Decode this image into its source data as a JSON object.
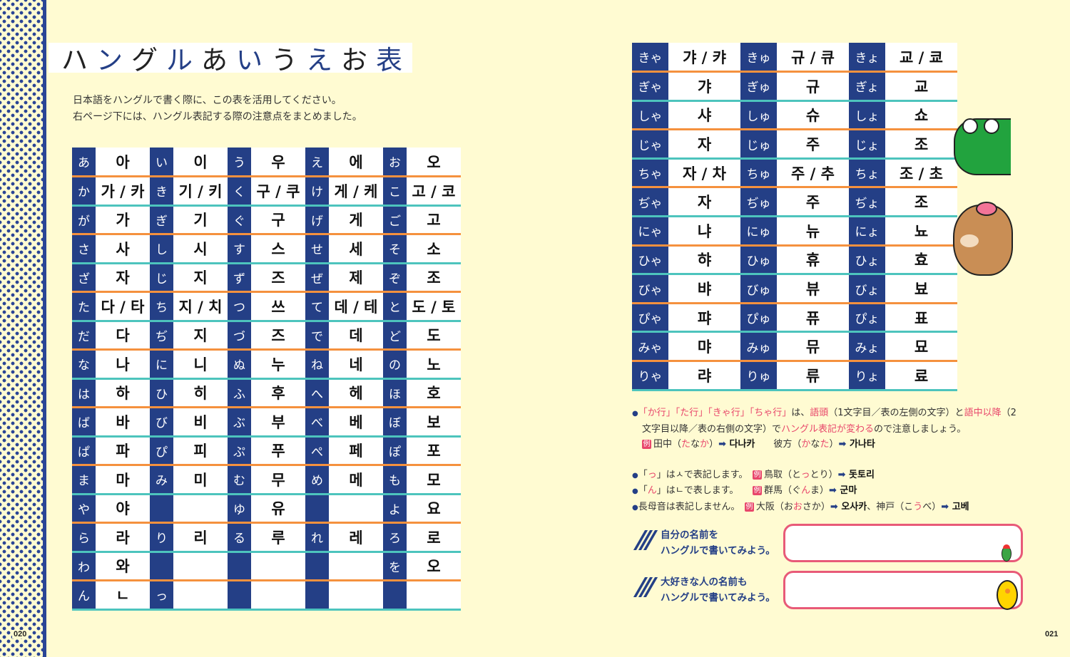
{
  "page_numbers": {
    "left": "020",
    "right": "021"
  },
  "title": {
    "parts": [
      {
        "t": "ハ",
        "c": "k"
      },
      {
        "t": "ン",
        "c": "b"
      },
      {
        "t": "グ",
        "c": "k"
      },
      {
        "t": "ル",
        "c": "b"
      },
      {
        "t": "あ",
        "c": "k"
      },
      {
        "t": "い",
        "c": "b"
      },
      {
        "t": "う",
        "c": "k"
      },
      {
        "t": "え",
        "c": "b"
      },
      {
        "t": "お",
        "c": "k"
      },
      {
        "t": "表",
        "c": "b"
      }
    ]
  },
  "intro": [
    "日本語をハングルで書く際に、この表を活用してください。",
    "右ページ下には、ハングル表記する際の注意点をまとめました。"
  ],
  "left_table": [
    [
      "あ",
      "아",
      "い",
      "이",
      "う",
      "우",
      "え",
      "에",
      "お",
      "오"
    ],
    [
      "か",
      "가 / 카",
      "き",
      "기 / 키",
      "く",
      "구 / 쿠",
      "け",
      "게 / 케",
      "こ",
      "고 / 코"
    ],
    [
      "が",
      "가",
      "ぎ",
      "기",
      "ぐ",
      "구",
      "げ",
      "게",
      "ご",
      "고"
    ],
    [
      "さ",
      "사",
      "し",
      "시",
      "す",
      "스",
      "せ",
      "세",
      "そ",
      "소"
    ],
    [
      "ざ",
      "자",
      "じ",
      "지",
      "ず",
      "즈",
      "ぜ",
      "제",
      "ぞ",
      "조"
    ],
    [
      "た",
      "다 / 타",
      "ち",
      "지 / 치",
      "つ",
      "쓰",
      "て",
      "데 / 테",
      "と",
      "도 / 토"
    ],
    [
      "だ",
      "다",
      "ぢ",
      "지",
      "づ",
      "즈",
      "で",
      "데",
      "ど",
      "도"
    ],
    [
      "な",
      "나",
      "に",
      "니",
      "ぬ",
      "누",
      "ね",
      "네",
      "の",
      "노"
    ],
    [
      "は",
      "하",
      "ひ",
      "히",
      "ふ",
      "후",
      "へ",
      "헤",
      "ほ",
      "호"
    ],
    [
      "ば",
      "바",
      "び",
      "비",
      "ぶ",
      "부",
      "べ",
      "베",
      "ぼ",
      "보"
    ],
    [
      "ぱ",
      "파",
      "ぴ",
      "피",
      "ぷ",
      "푸",
      "ぺ",
      "페",
      "ぽ",
      "포"
    ],
    [
      "ま",
      "마",
      "み",
      "미",
      "む",
      "무",
      "め",
      "메",
      "も",
      "모"
    ],
    [
      "や",
      "야",
      "",
      "",
      "ゆ",
      "유",
      "",
      "",
      "よ",
      "요"
    ],
    [
      "ら",
      "라",
      "り",
      "리",
      "る",
      "루",
      "れ",
      "레",
      "ろ",
      "로"
    ],
    [
      "わ",
      "와",
      "",
      "",
      "",
      "",
      "",
      "",
      "を",
      "오"
    ],
    [
      "ん",
      "ㄴ",
      "っ",
      "",
      "",
      "",
      "",
      "",
      "",
      ""
    ]
  ],
  "right_table": [
    [
      "きゃ",
      "갸 / 캬",
      "きゅ",
      "규 / 큐",
      "きょ",
      "교 / 쿄"
    ],
    [
      "ぎゃ",
      "갸",
      "ぎゅ",
      "규",
      "ぎょ",
      "교"
    ],
    [
      "しゃ",
      "샤",
      "しゅ",
      "슈",
      "しょ",
      "쇼"
    ],
    [
      "じゃ",
      "자",
      "じゅ",
      "주",
      "じょ",
      "조"
    ],
    [
      "ちゃ",
      "자 / 차",
      "ちゅ",
      "주 / 추",
      "ちょ",
      "조 / 초"
    ],
    [
      "ぢゃ",
      "자",
      "ぢゅ",
      "주",
      "ぢょ",
      "조"
    ],
    [
      "にゃ",
      "냐",
      "にゅ",
      "뉴",
      "にょ",
      "뇨"
    ],
    [
      "ひゃ",
      "햐",
      "ひゅ",
      "휴",
      "ひょ",
      "효"
    ],
    [
      "びゃ",
      "뱌",
      "びゅ",
      "뷰",
      "びょ",
      "뵤"
    ],
    [
      "ぴゃ",
      "퍄",
      "ぴゅ",
      "퓨",
      "ぴょ",
      "표"
    ],
    [
      "みゃ",
      "먀",
      "みゅ",
      "뮤",
      "みょ",
      "묘"
    ],
    [
      "りゃ",
      "랴",
      "りゅ",
      "류",
      "りょ",
      "료"
    ]
  ],
  "notes": [
    {
      "bullet": true,
      "parts": [
        {
          "t": "「か行」「た行」「きゃ行」「ちゃ行」",
          "s": "hl"
        },
        {
          "t": "は、"
        },
        {
          "t": "語頭",
          "s": "hl"
        },
        {
          "t": "（1文字目／表の左側の文字）と"
        },
        {
          "t": "語中以降",
          "s": "hl"
        },
        {
          "t": "（2"
        }
      ]
    },
    {
      "bullet": false,
      "indent": true,
      "parts": [
        {
          "t": "文字目以降／表の右側の文字）で"
        },
        {
          "t": "ハングル表記が変わる",
          "s": "hl"
        },
        {
          "t": "ので注意しましょう。"
        }
      ]
    },
    {
      "bullet": false,
      "indent": true,
      "parts": [
        {
          "t": "例",
          "s": "rei"
        },
        {
          "t": "田中（"
        },
        {
          "t": "た",
          "s": "hl"
        },
        {
          "t": "な"
        },
        {
          "t": "か",
          "s": "hl"
        },
        {
          "t": "）"
        },
        {
          "t": "➡",
          "s": "arr"
        },
        {
          "t": " 다나카",
          "s": "kr"
        },
        {
          "t": "　　彼方（"
        },
        {
          "t": "か",
          "s": "hl"
        },
        {
          "t": "な"
        },
        {
          "t": "た",
          "s": "hl"
        },
        {
          "t": "）"
        },
        {
          "t": "➡",
          "s": "arr"
        },
        {
          "t": " 가나타",
          "s": "kr"
        }
      ]
    },
    {
      "bullet": false,
      "blank": true,
      "parts": []
    },
    {
      "bullet": true,
      "parts": [
        {
          "t": "「"
        },
        {
          "t": "っ",
          "s": "hl"
        },
        {
          "t": "」はㅅで表記します。　"
        },
        {
          "t": "例",
          "s": "rei"
        },
        {
          "t": "鳥取（と"
        },
        {
          "t": "っ",
          "s": "hl"
        },
        {
          "t": "とり）"
        },
        {
          "t": "➡",
          "s": "arr"
        },
        {
          "t": " 돗토리",
          "s": "kr"
        }
      ]
    },
    {
      "bullet": true,
      "parts": [
        {
          "t": "「"
        },
        {
          "t": "ん",
          "s": "hl"
        },
        {
          "t": "」はㄴで表します。　　"
        },
        {
          "t": "例",
          "s": "rei"
        },
        {
          "t": "群馬（ぐ"
        },
        {
          "t": "ん",
          "s": "hl"
        },
        {
          "t": "ま）"
        },
        {
          "t": "➡",
          "s": "arr"
        },
        {
          "t": " 군마",
          "s": "kr"
        }
      ]
    },
    {
      "bullet": true,
      "parts": [
        {
          "t": "長母音は表記しません。　"
        },
        {
          "t": "例",
          "s": "rei"
        },
        {
          "t": "大阪（お"
        },
        {
          "t": "お",
          "s": "hl"
        },
        {
          "t": "さか）"
        },
        {
          "t": "➡",
          "s": "arr"
        },
        {
          "t": " 오사카",
          "s": "kr"
        },
        {
          "t": "、神戸（こ"
        },
        {
          "t": "う",
          "s": "hl"
        },
        {
          "t": "べ）"
        },
        {
          "t": "➡",
          "s": "arr"
        },
        {
          "t": " 고베",
          "s": "kr"
        }
      ]
    }
  ],
  "write_prompts": [
    {
      "lines": [
        "自分の名前を",
        "ハングルで書いてみよう。"
      ]
    },
    {
      "lines": [
        "大好きな人の名前も",
        "ハングルで書いてみよう。"
      ]
    }
  ],
  "colors": {
    "navy": "#243f86",
    "orange": "#f5913e",
    "teal": "#4dc4bd",
    "pink": "#e8476b",
    "background": "#fffbd2"
  }
}
